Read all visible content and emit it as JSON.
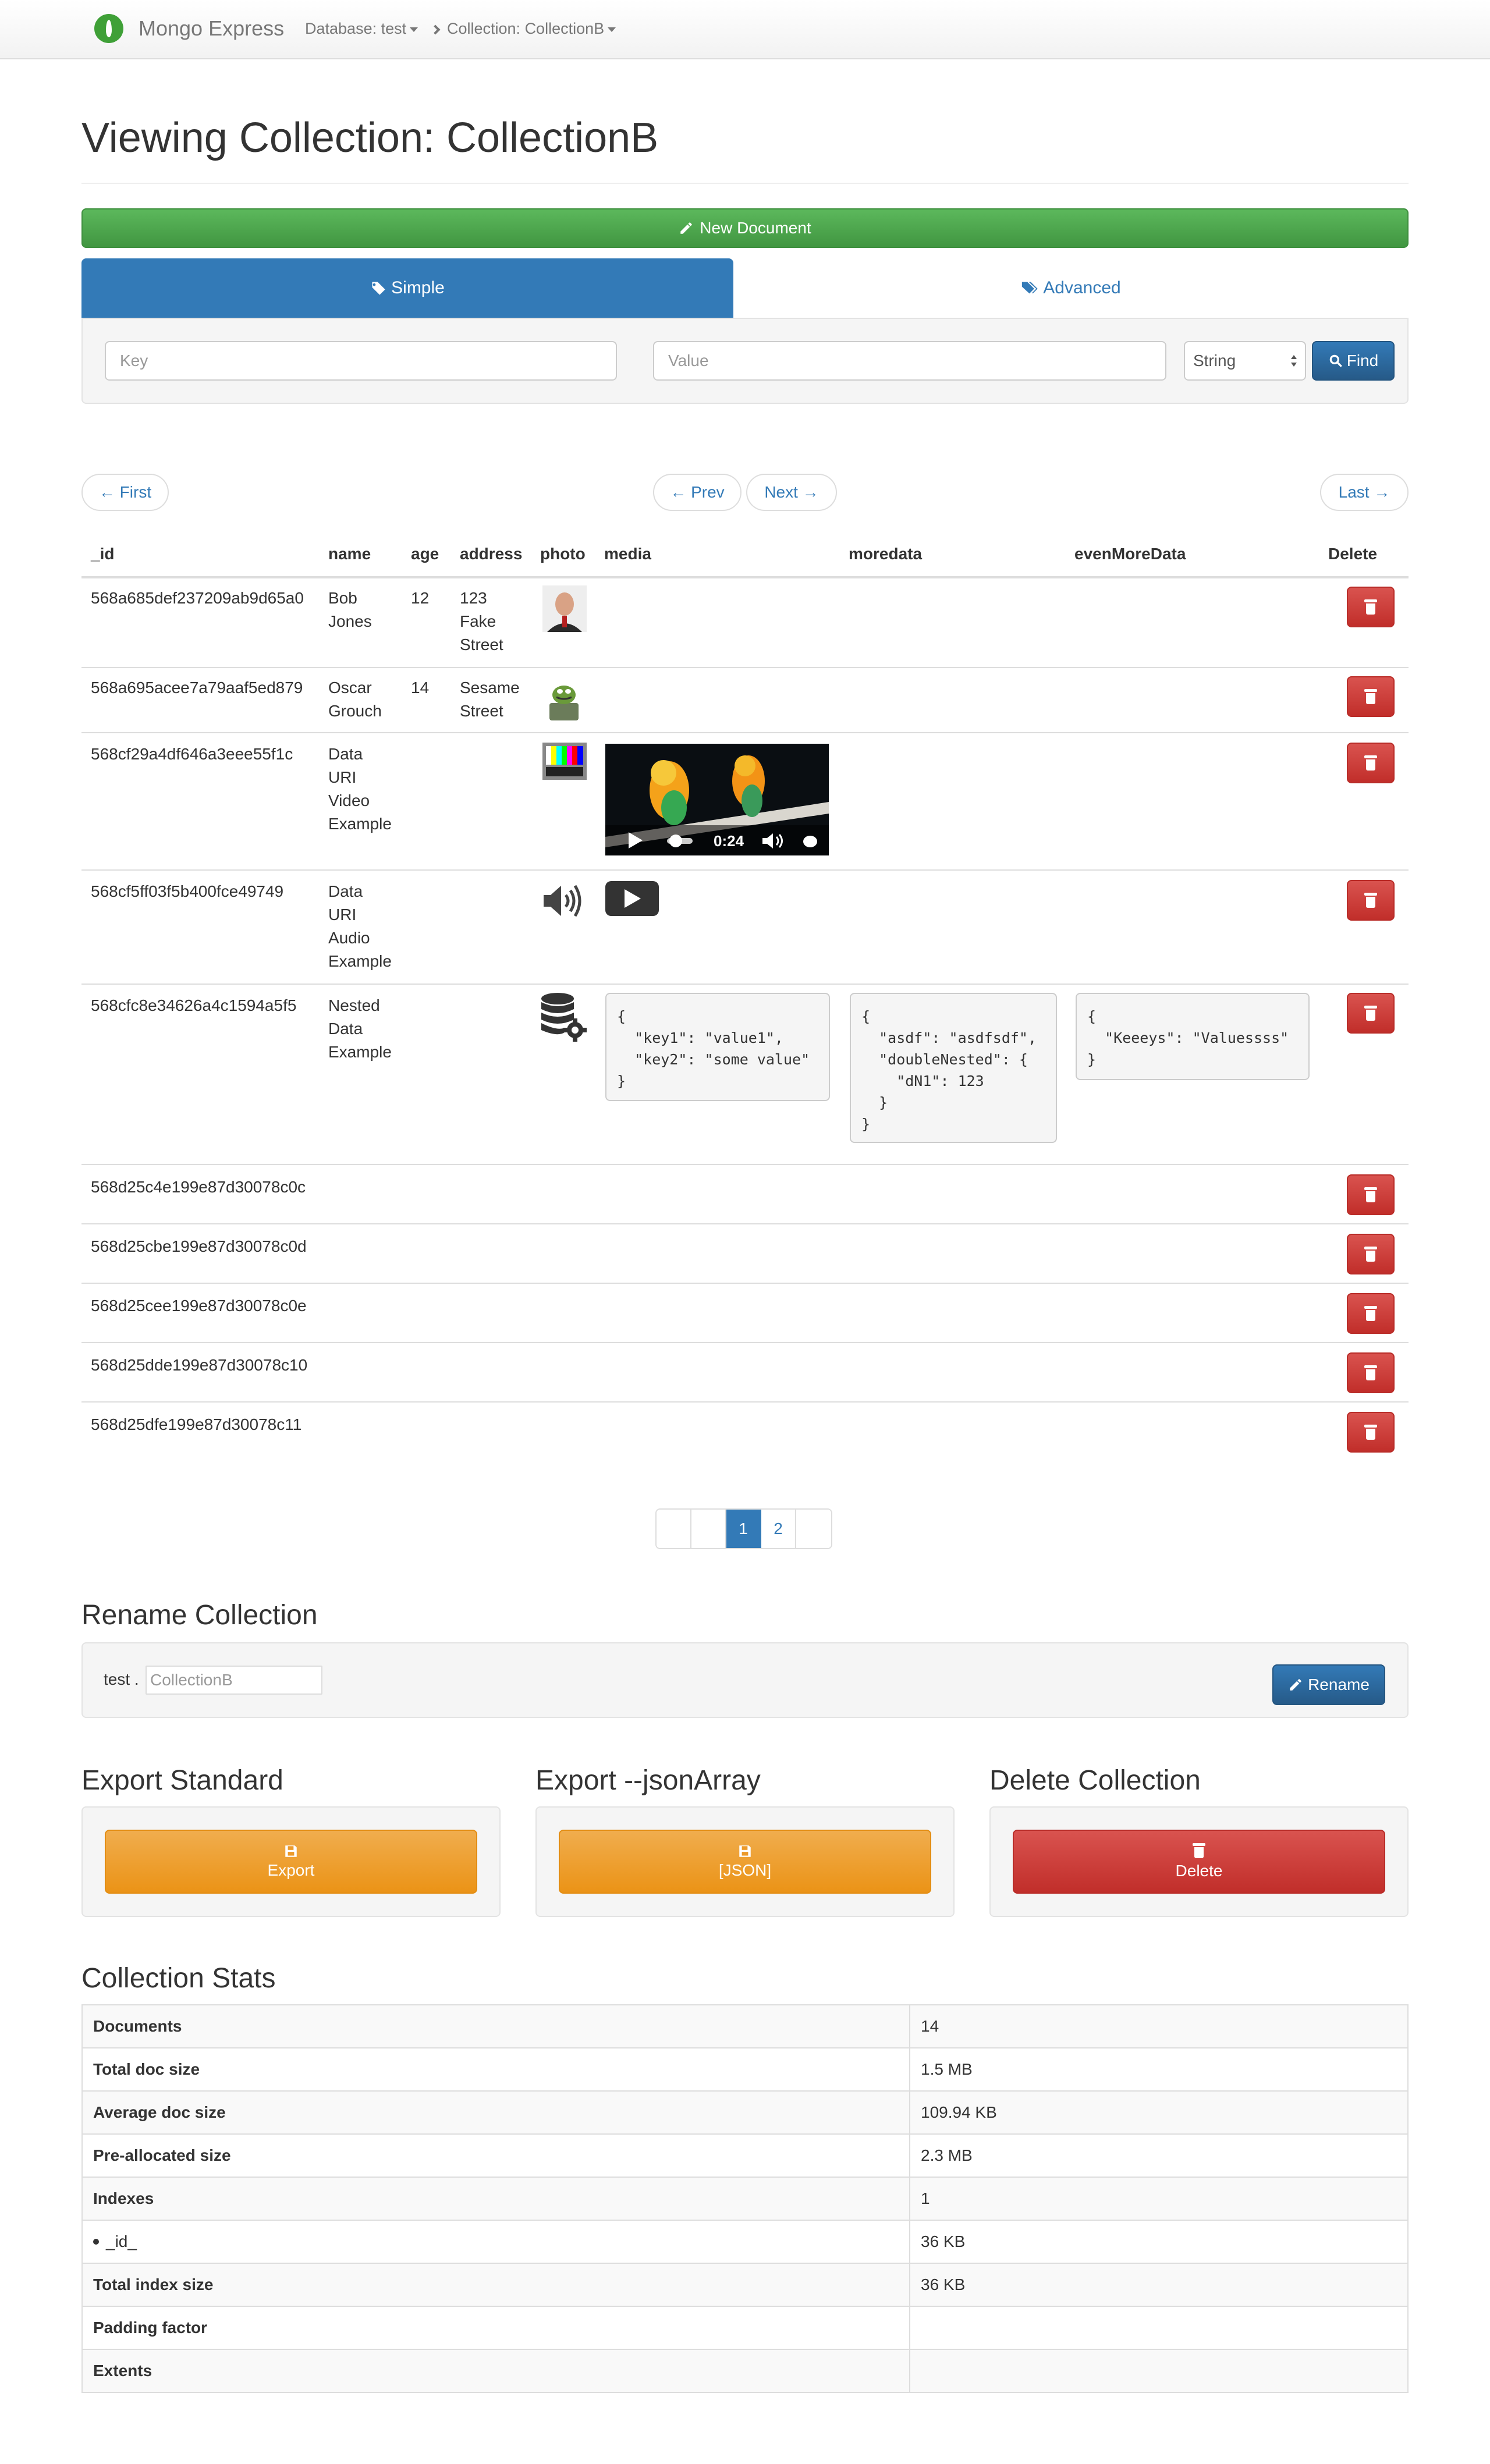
{
  "navbar": {
    "brand": "Mongo Express",
    "database": "Database: test",
    "collection": "Collection: CollectionB"
  },
  "page_title": "Viewing Collection: CollectionB",
  "actions": {
    "new_document": "New Document"
  },
  "tabs": {
    "simple": "Simple",
    "advanced": "Advanced"
  },
  "search": {
    "key_placeholder": "Key",
    "value_placeholder": "Value",
    "type_selected": "String",
    "find_label": "Find"
  },
  "pager": {
    "first": "← First",
    "prev": "← Prev",
    "next": "Next →",
    "last": "Last →"
  },
  "table": {
    "headers": [
      "_id",
      "name",
      "age",
      "address",
      "photo",
      "media",
      "moredata",
      "evenMoreData",
      "Delete"
    ],
    "rows": [
      {
        "id": "568a685def237209ab9d65a0",
        "name": "Bob Jones",
        "age": "12",
        "address": "123 Fake Street",
        "photo": "portrait-photo"
      },
      {
        "id": "568a695acee7a79aaf5ed879",
        "name": "Oscar Grouch",
        "age": "14",
        "address": "Sesame Street",
        "photo": "grouch-photo"
      },
      {
        "id": "568cf29a4df646a3eee55f1c",
        "name": "Data URI Video Example",
        "photo": "test-pattern-image",
        "media": {
          "time": "0:24"
        }
      },
      {
        "id": "568cf5ff03f5b400fce49749",
        "name": "Data URI Audio Example",
        "photo": "speaker-icon",
        "media": "play-icon"
      },
      {
        "id": "568cfc8e34626a4c1594a5f5",
        "name": "Nested Data Example",
        "photo": "database-gear-icon",
        "media": "{\n  \"key1\": \"value1\",\n  \"key2\": \"some value\"\n}",
        "moredata": "{\n  \"asdf\": \"asdfsdf\",\n  \"doubleNested\": {\n    \"dN1\": 123\n  }\n}",
        "evenMoreData": "{\n  \"Keeeys\": \"Valuessss\"\n}"
      },
      {
        "id": "568d25c4e199e87d30078c0c"
      },
      {
        "id": "568d25cbe199e87d30078c0d"
      },
      {
        "id": "568d25cee199e87d30078c0e"
      },
      {
        "id": "568d25dde199e87d30078c10"
      },
      {
        "id": "568d25dfe199e87d30078c11"
      }
    ]
  },
  "pagination": {
    "pages": [
      "1",
      "2"
    ],
    "active": "1"
  },
  "rename": {
    "heading": "Rename Collection",
    "db_prefix": "test .",
    "input_placeholder": "CollectionB",
    "button": "Rename"
  },
  "export_standard": {
    "heading": "Export Standard",
    "button": "Export"
  },
  "export_json": {
    "heading": "Export --jsonArray",
    "button": "[JSON]"
  },
  "delete_collection": {
    "heading": "Delete Collection",
    "button": "Delete"
  },
  "stats": {
    "heading": "Collection Stats",
    "rows": [
      {
        "k": "Documents",
        "v": "14"
      },
      {
        "k": "Total doc size",
        "v": "1.5 MB"
      },
      {
        "k": "Average doc size",
        "v": "109.94 KB"
      },
      {
        "k": "Pre-allocated size",
        "v": "2.3 MB"
      },
      {
        "k": "Indexes",
        "v": "1"
      },
      {
        "k": "_id_",
        "v": "36 KB",
        "bullet": true
      },
      {
        "k": "Total index size",
        "v": "36 KB"
      },
      {
        "k": "Padding factor",
        "v": ""
      },
      {
        "k": "Extents",
        "v": ""
      }
    ]
  },
  "colors": {
    "primary": "#337ab7",
    "success": "#5cb85c",
    "danger": "#d9534f",
    "warning": "#f0ad4e",
    "brand_green": "#3fa037"
  }
}
